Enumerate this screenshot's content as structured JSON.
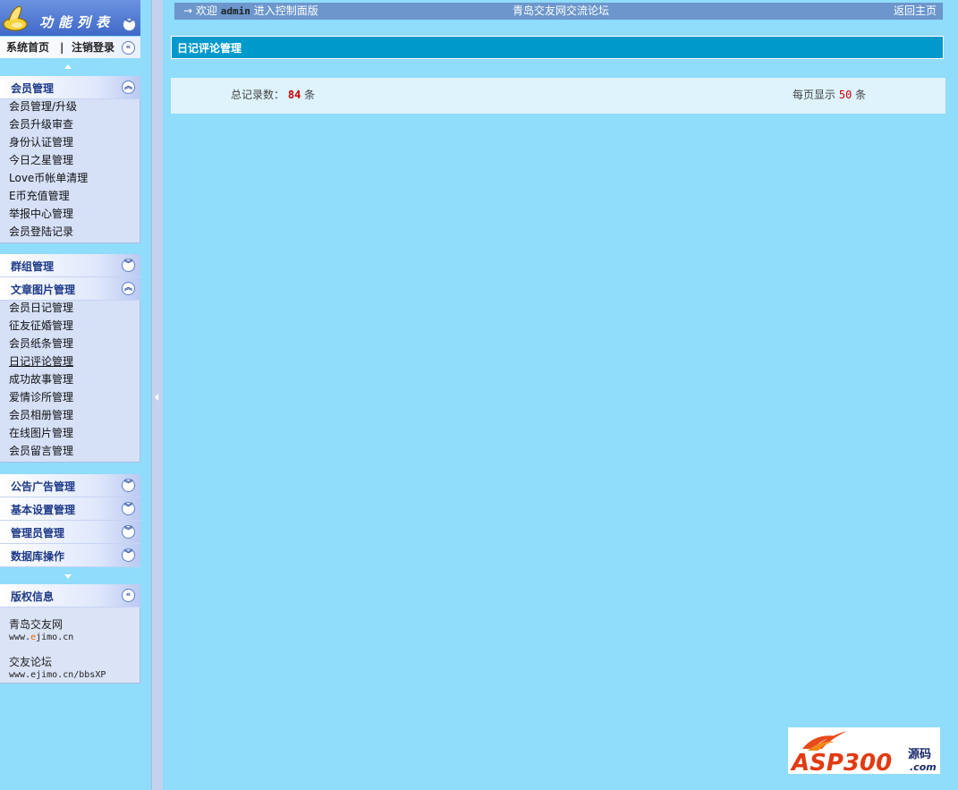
{
  "sidebar": {
    "header_title": "功能列表",
    "quick_links": {
      "home": "系统首页",
      "separator": "|",
      "logout": "注销登录"
    },
    "groups": [
      {
        "label": "会员管理",
        "expanded": true,
        "items": [
          "会员管理/升级",
          "会员升级审查",
          "身份认证管理",
          "今日之星管理",
          "Love币帐单清理",
          "E币充值管理",
          "举报中心管理",
          "会员登陆记录"
        ]
      },
      {
        "label": "群组管理",
        "expanded": false,
        "items": []
      },
      {
        "label": "文章图片管理",
        "expanded": true,
        "items": [
          "会员日记管理",
          "征友征婚管理",
          "会员纸条管理",
          "日记评论管理",
          "成功故事管理",
          "爱情诊所管理",
          "会员相册管理",
          "在线图片管理",
          "会员留言管理"
        ]
      },
      {
        "label": "公告广告管理",
        "expanded": false,
        "items": []
      },
      {
        "label": "基本设置管理",
        "expanded": false,
        "items": []
      },
      {
        "label": "管理员管理",
        "expanded": false,
        "items": []
      },
      {
        "label": "数据库操作",
        "expanded": false,
        "items": []
      }
    ],
    "copyright": {
      "label": "版权信息",
      "site1_name": "青岛交友网",
      "site1_url_pre": "www.",
      "site1_url_hl": "e",
      "site1_url_post": "jimo.cn",
      "site2_name": "交友论坛",
      "site2_url": "www.ejimo.cn/bbsXP"
    }
  },
  "topbar": {
    "arrow": "→",
    "welcome_prefix": "欢迎",
    "username": "admin",
    "welcome_suffix": "进入控制面版",
    "center_text": "青岛交友网交流论坛",
    "return_link": "返回主页"
  },
  "main": {
    "title": "日记评论管理",
    "total_label": "总记录数：",
    "total_value": "84",
    "unit": "条",
    "per_page_label": "每页显示",
    "per_page_value": "50",
    "per_page_unit": "条"
  },
  "watermark": {
    "text_main": "ASP300",
    "text_cn": "源码",
    "text_com": ".com"
  },
  "colors": {
    "background": "#8fdcfb",
    "title_bar": "#0099cc",
    "topbar": "#6c96cc",
    "highlight_red": "#cc0000"
  }
}
